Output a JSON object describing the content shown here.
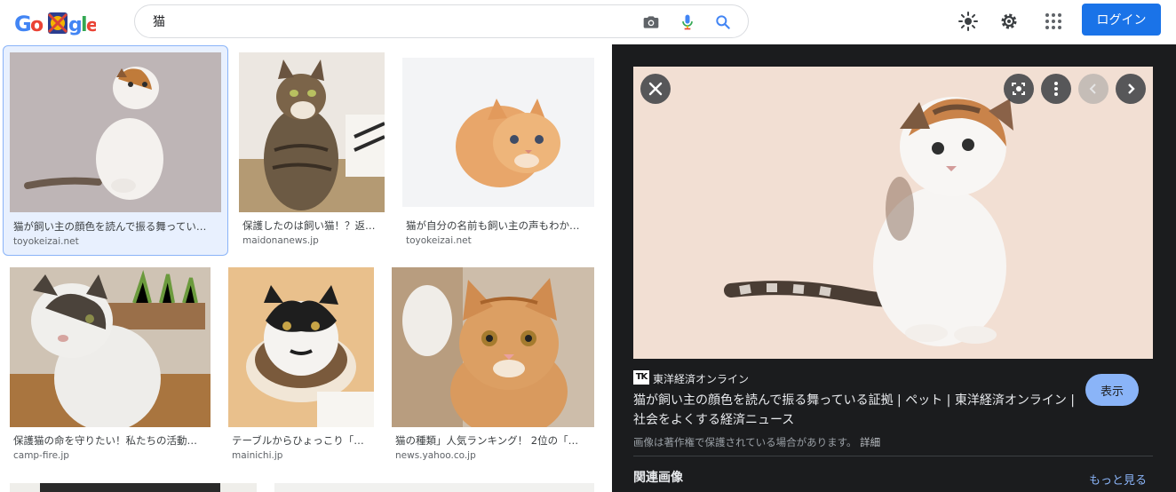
{
  "header": {
    "logo_text": "Google",
    "search_value": "猫",
    "login_label": "ログイン",
    "icons": [
      "camera-icon",
      "mic-icon",
      "search-icon",
      "brightness-icon",
      "gear-icon",
      "apps-icon"
    ]
  },
  "results": [
    {
      "caption": "猫が飼い主の顔色を読んで振る舞ってい…",
      "source": "toyokeizai.net",
      "selected": true
    },
    {
      "caption": "保護したのは飼い猫！？返…",
      "source": "maidonanews.jp"
    },
    {
      "caption": "猫が自分の名前も飼い主の声もわか…",
      "source": "toyokeizai.net"
    },
    {
      "caption": "保護猫の命を守りたい！私たちの活動…",
      "source": "camp-fire.jp"
    },
    {
      "caption": "テーブルからひょっこり「…",
      "source": "mainichi.jp"
    },
    {
      "caption": "猫の種類」人気ランキング！ 2位の「…",
      "source": "news.yahoo.co.jp"
    }
  ],
  "preview": {
    "site_logo": "TK",
    "site_name": "東洋経済オンライン",
    "title": "猫が飼い主の顔色を読んで振る舞っている証拠 | ペット | 東洋経済オンライン | 社会をよくする経済ニュース",
    "view_label": "表示",
    "copyright": "画像は著作権で保護されている場合があります。",
    "details_link": "詳細",
    "related_title": "関連画像",
    "more_link": "もっと見る"
  },
  "colors": {
    "accent": "#1a73e8",
    "panel_bg": "#1b1c1e",
    "link": "#8ab4f8"
  }
}
